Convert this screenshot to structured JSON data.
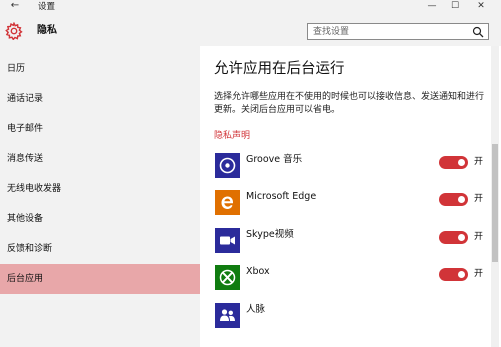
{
  "window": {
    "back_glyph": "←",
    "title": "设置",
    "min_glyph": "—",
    "max_glyph": "☐",
    "close_glyph": "✕"
  },
  "header": {
    "icon": "gear-icon",
    "title": "隐私"
  },
  "search": {
    "placeholder": "查找设置",
    "icon": "search-icon"
  },
  "sidebar": {
    "items": [
      {
        "label": "日历"
      },
      {
        "label": "通话记录"
      },
      {
        "label": "电子邮件"
      },
      {
        "label": "消息传送"
      },
      {
        "label": "无线电收发器"
      },
      {
        "label": "其他设备"
      },
      {
        "label": "反馈和诊断"
      },
      {
        "label": "后台应用",
        "selected": true
      }
    ]
  },
  "main": {
    "title": "允许应用在后台运行",
    "description": "选择允许哪些应用在不使用的时候也可以接收信息、发送通知和进行更新。关闭后台应用可以省电。",
    "privacy_link": "隐私声明",
    "apps": [
      {
        "name": "Groove 音乐",
        "icon": "groove-music-icon",
        "icon_color": "#2b2b9b",
        "toggle_on": true,
        "toggle_label": "开"
      },
      {
        "name": "Microsoft Edge",
        "icon": "edge-icon",
        "icon_color": "#e07000",
        "toggle_on": true,
        "toggle_label": "开"
      },
      {
        "name": "Skype视频",
        "icon": "skype-video-icon",
        "icon_color": "#2b2b9b",
        "toggle_on": true,
        "toggle_label": "开"
      },
      {
        "name": "Xbox",
        "icon": "xbox-icon",
        "icon_color": "#107c10",
        "toggle_on": true,
        "toggle_label": "开"
      },
      {
        "name": "人脉",
        "icon": "people-icon",
        "icon_color": "#2b2b9b"
      }
    ]
  },
  "colors": {
    "accent": "#d13438",
    "selected_bg": "#e8a7a9",
    "sidebar_bg": "#f2f2f2"
  }
}
